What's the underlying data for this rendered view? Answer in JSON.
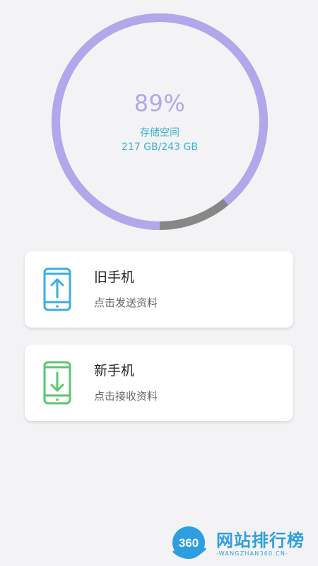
{
  "storage": {
    "percent_text": "89%",
    "label": "存储空间",
    "amount": "217 GB/243 GB",
    "used_fraction": 0.89,
    "colors": {
      "used": "#b0a8ea",
      "free": "#878787",
      "percent_text": "#b0a8ea",
      "label_text": "#3cb1d3"
    }
  },
  "cards": [
    {
      "title": "旧手机",
      "subtitle": "点击发送资料",
      "icon": "phone-upload-icon",
      "color": "#3aaee0"
    },
    {
      "title": "新手机",
      "subtitle": "点击接收资料",
      "icon": "phone-download-icon",
      "color": "#5cc56e"
    }
  ],
  "watermark": {
    "badge": "360",
    "title": "网站排行榜",
    "subtitle": "-WANGZHAN360.CN-",
    "color": "#2f9ee0"
  }
}
